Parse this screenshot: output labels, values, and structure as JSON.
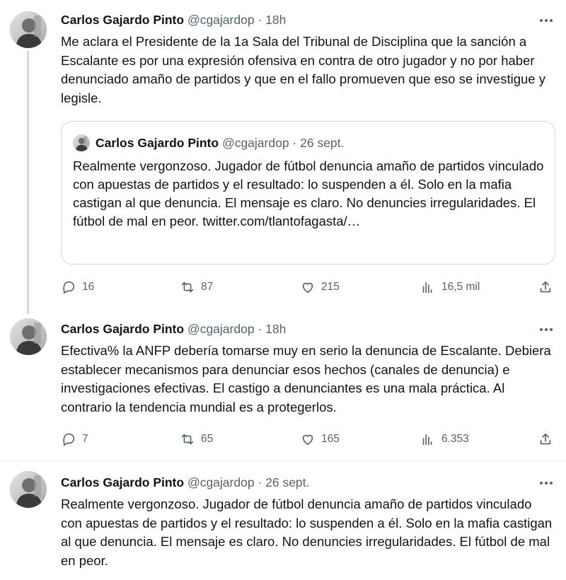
{
  "tweets": [
    {
      "name": "Carlos Gajardo Pinto",
      "meta": "@cgajardop · 18h",
      "text": "Me aclara el Presidente de la 1a Sala del Tribunal de Disciplina que  la sanción a Escalante es por una expresión ofensiva en contra de otro jugador y no por haber denunciado amaño de partidos y que en el fallo promueven que eso se investigue y legisle.",
      "quote": {
        "name": "Carlos Gajardo Pinto",
        "meta": "@cgajardop · 26 sept.",
        "text": "Realmente vergonzoso. Jugador de fútbol denuncia amaño de partidos vinculado con apuestas de partidos y el resultado: lo suspenden a él. Solo en la mafia castigan al que denuncia. El mensaje es claro. No denuncies irregularidades. El fútbol de mal en peor. twitter.com/tlantofagasta/…"
      },
      "replies": "16",
      "retweets": "87",
      "likes": "215",
      "views": "16,5 mil"
    },
    {
      "name": "Carlos Gajardo Pinto",
      "meta": "@cgajardop · 18h",
      "text": "Efectiva% la ANFP debería tomarse muy en serio la denuncia de Escalante. Debiera establecer mecanismos para denunciar esos hechos (canales de denuncia) e investigaciones efectivas. El castigo a denunciantes es una mala práctica. Al contrario la tendencia mundial es a protegerlos.",
      "replies": "7",
      "retweets": "65",
      "likes": "165",
      "views": "6.353"
    },
    {
      "name": "Carlos Gajardo Pinto",
      "meta": "@cgajardop · 26 sept.",
      "text": "Realmente vergonzoso. Jugador de fútbol denuncia amaño de partidos vinculado con apuestas de partidos y el resultado: lo suspenden a él. Solo en la mafia castigan al que denuncia. El mensaje es claro. No denuncies irregularidades. El fútbol de mal en peor."
    }
  ]
}
